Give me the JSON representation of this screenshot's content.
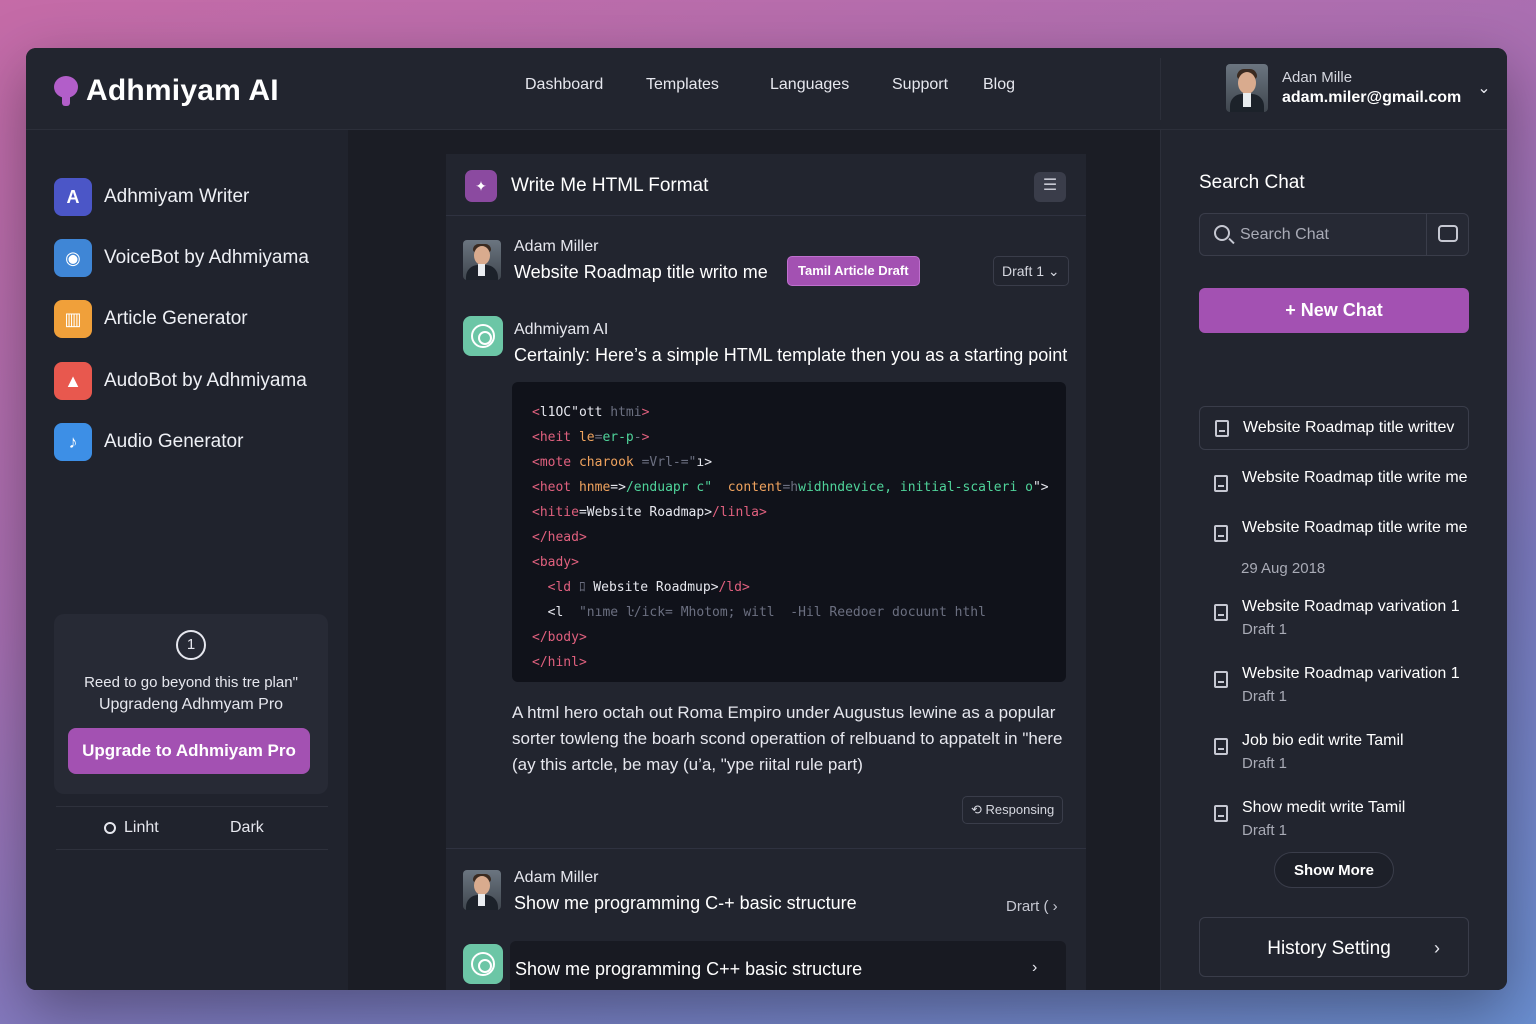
{
  "brand": {
    "name": "Adhmiyam AI"
  },
  "nav": [
    {
      "label": "Dashboard"
    },
    {
      "label": "Templates"
    },
    {
      "label": "Languages"
    },
    {
      "label": "Support"
    },
    {
      "label": "Blog"
    }
  ],
  "user": {
    "name": "Adan Mille",
    "email": "adam.miler@gmail.com"
  },
  "tools": [
    {
      "label": "Adhmiyam Writer",
      "icon": "writer-a-icon",
      "color": "#4b56c7"
    },
    {
      "label": "VoiceBot by Adhmiyama",
      "icon": "voicebot-icon",
      "color": "#3f86d6"
    },
    {
      "label": "Article Generator",
      "icon": "article-icon",
      "color": "#f0a03a"
    },
    {
      "label": "AudoBot by Adhmiyama",
      "icon": "audobot-icon",
      "color": "#e8584e"
    },
    {
      "label": "Audio Generator",
      "icon": "audio-icon",
      "color": "#3d8fe6"
    }
  ],
  "promo": {
    "badge": "1",
    "text1": "Reed to go beyond this tre plan\"",
    "text2": "Upgradeng Adhmyam Pro",
    "button": "Upgrade to Adhmiyam Pro"
  },
  "theme": {
    "light": "Linht",
    "dark": "Dark"
  },
  "chat": {
    "title": "Write Me HTML Format",
    "menu_glyph": "☰",
    "msg1": {
      "author": "Adam Miller",
      "text": "Website Roadmap title writo me",
      "tag": "Tamil Article Draft",
      "draft": "Draft 1 ⌄"
    },
    "msg2": {
      "author": "Adhmiyam AI",
      "text": "Certainly: Here’s a simple HTML template  then you as a starting point"
    },
    "code": [
      [
        [
          "c-tag",
          "<"
        ],
        [
          "c-txt",
          "l1OC\"ott "
        ],
        [
          "c-dim",
          "htmi"
        ],
        [
          "c-tag",
          ">"
        ]
      ],
      [
        [
          "c-tag",
          "<heit "
        ],
        [
          "c-attr",
          "le"
        ],
        [
          "c-dim",
          "="
        ],
        [
          "c-str",
          "er-p"
        ],
        [
          "c-dim",
          "-"
        ],
        [
          "c-tag",
          ">"
        ]
      ],
      [
        [
          "c-tag",
          "<mote "
        ],
        [
          "c-attr",
          "charook "
        ],
        [
          "c-dim",
          "=Vrl-=\""
        ],
        [
          "c-txt",
          "ı>"
        ]
      ],
      [
        [
          "c-tag",
          "<heot "
        ],
        [
          "c-attr",
          "hnme"
        ],
        [
          "c-txt",
          "=>"
        ],
        [
          "c-str",
          "/enduapr c\"  "
        ],
        [
          "c-attr",
          "content"
        ],
        [
          "c-dim",
          "=h"
        ],
        [
          "c-str",
          "widhndevice, initial-scaleri o"
        ],
        [
          "c-txt",
          "\">"
        ]
      ],
      [
        [
          "c-tag",
          "<hitie"
        ],
        [
          "c-txt",
          "=Website Roadmap>"
        ],
        [
          "c-tag",
          "/linla>"
        ]
      ],
      [
        [
          "c-tag",
          "</head>"
        ]
      ],
      [
        [
          "c-tag",
          "<bady>"
        ]
      ],
      [
        [
          "c-txt",
          "  "
        ],
        [
          "c-tag",
          "<ld "
        ],
        [
          "c-dim",
          "ﾛ "
        ],
        [
          "c-txt",
          "Website Roadmup>"
        ],
        [
          "c-tag",
          "/ld>"
        ]
      ],
      [
        [
          "c-txt",
          "  <l  "
        ],
        [
          "c-dim",
          "\"nıme ŀ/ick= Mhotom; witl  -Hil Reedoer docuunt hthl"
        ]
      ],
      [
        [
          "c-tag",
          "</body>"
        ]
      ],
      [
        [
          "c-tag",
          "</hinl>"
        ]
      ]
    ],
    "paragraph": "A html hero octah out Roma Empiro under Augustus lewine as a popular sorter towleng the boarh scond operattion of relbuand to appatelt in \"here (ay this artcle, be may (u’a, \"ype riital rule part)",
    "responding": "Responsing",
    "msg3": {
      "author": "Adam Miller",
      "text": "Show me programming C-+ basic structure",
      "draft": "Drart ( ›"
    },
    "prompt": {
      "text": "Show me programming C++ basic structure",
      "arrow": "›"
    }
  },
  "right": {
    "title": "Search Chat",
    "search_placeholder": "Search Chat",
    "new_chat": "+ New Chat",
    "history": [
      {
        "title": "Website Roadmap title writtev",
        "sub": ""
      },
      {
        "title": "Website Roadmap title write me",
        "sub": ""
      },
      {
        "title": "Website Roadmap title write me",
        "sub": ""
      },
      {
        "title": "Website Roadmap  varivation 1",
        "sub": "Draft 1"
      },
      {
        "title": "Website Roadmap  varivation 1",
        "sub": "Draft 1"
      },
      {
        "title": "Job bio edit write Tamil",
        "sub": "Draft 1"
      },
      {
        "title": "Show medit write Tamil",
        "sub": "Draft 1"
      }
    ],
    "date_label": "29 Aug 2018",
    "show_more": "Show More",
    "history_setting": "History Setting",
    "history_setting_arrow": "›"
  },
  "colors": {
    "accent": "#a351b2",
    "ai_green": "#6cc6a6"
  }
}
